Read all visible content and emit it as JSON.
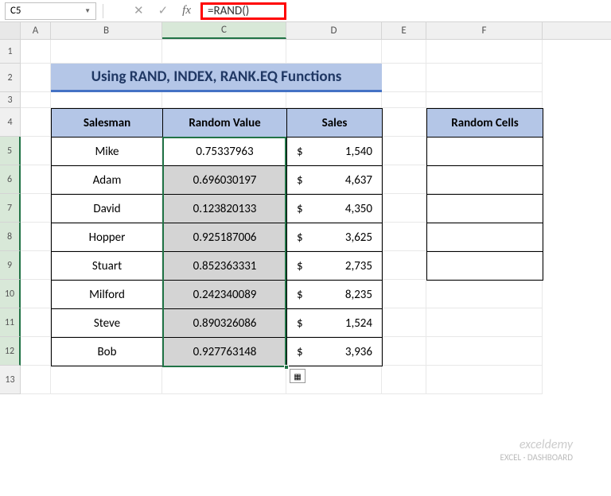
{
  "nameBox": "C5",
  "formula": "=RAND()",
  "colHeaders": [
    "A",
    "B",
    "C",
    "D",
    "E",
    "F"
  ],
  "rowHeaders": [
    "1",
    "2",
    "3",
    "4",
    "5",
    "6",
    "7",
    "8",
    "9",
    "10",
    "11",
    "12",
    "13"
  ],
  "title": "Using RAND, INDEX, RANK.EQ Functions",
  "headers": {
    "salesman": "Salesman",
    "randomValue": "Random Value",
    "sales": "Sales",
    "randomCells": "Random Cells"
  },
  "rows": [
    {
      "salesman": "Mike",
      "rv": "0.75337963",
      "sym": "$",
      "sales": "1,540"
    },
    {
      "salesman": "Adam",
      "rv": "0.696030197",
      "sym": "$",
      "sales": "4,637"
    },
    {
      "salesman": "David",
      "rv": "0.123820133",
      "sym": "$",
      "sales": "4,350"
    },
    {
      "salesman": "Hopper",
      "rv": "0.925187006",
      "sym": "$",
      "sales": "3,625"
    },
    {
      "salesman": "Stuart",
      "rv": "0.852363331",
      "sym": "$",
      "sales": "2,735"
    },
    {
      "salesman": "Milford",
      "rv": "0.242340089",
      "sym": "$",
      "sales": "8,235"
    },
    {
      "salesman": "Steve",
      "rv": "0.890326086",
      "sym": "$",
      "sales": "1,524"
    },
    {
      "salesman": "Bob",
      "rv": "0.927763148",
      "sym": "$",
      "sales": "3,936"
    }
  ],
  "watermark": {
    "line1": "exceldemy",
    "line2": "EXCEL · DASHBOARD"
  },
  "chart_data": {
    "type": "table",
    "title": "Using RAND, INDEX, RANK.EQ Functions",
    "columns": [
      "Salesman",
      "Random Value",
      "Sales"
    ],
    "data": [
      [
        "Mike",
        0.75337963,
        1540
      ],
      [
        "Adam",
        0.696030197,
        4637
      ],
      [
        "David",
        0.123820133,
        4350
      ],
      [
        "Hopper",
        0.925187006,
        3625
      ],
      [
        "Stuart",
        0.852363331,
        2735
      ],
      [
        "Milford",
        0.242340089,
        8235
      ],
      [
        "Steve",
        0.890326086,
        1524
      ],
      [
        "Bob",
        0.927763148,
        3936
      ]
    ]
  }
}
